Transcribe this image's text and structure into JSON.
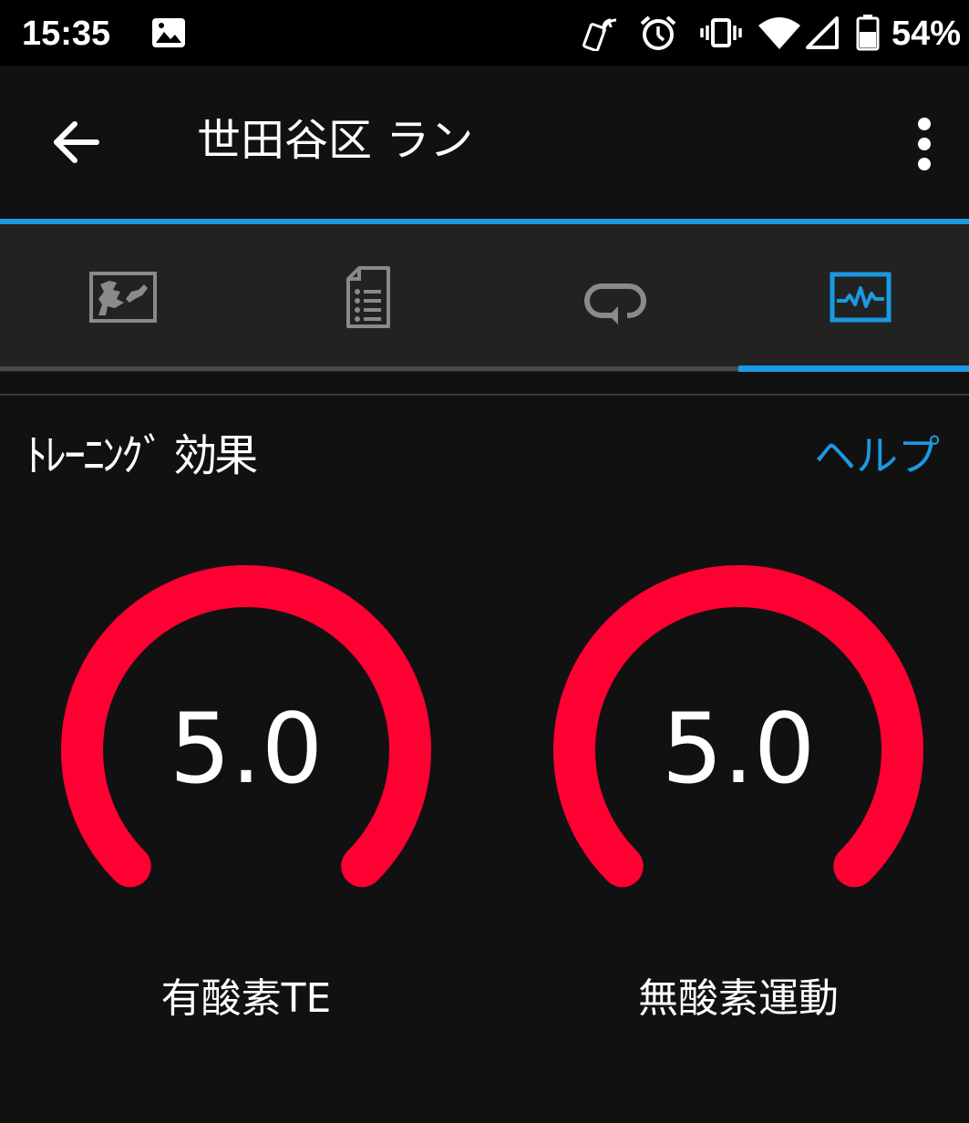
{
  "status_bar": {
    "time": "15:35",
    "battery_percent": "54%",
    "icons": [
      "gallery-icon",
      "nfc-phone-icon",
      "alarm-icon",
      "vibrate-icon",
      "wifi-icon",
      "cell-signal-icon",
      "battery-icon"
    ]
  },
  "app_bar": {
    "title": "世田谷区 ラン",
    "back_icon": "arrow-back-icon",
    "menu_icon": "more-vert-icon"
  },
  "tabs": [
    {
      "icon": "map-icon",
      "selected": false
    },
    {
      "icon": "details-document-icon",
      "selected": false
    },
    {
      "icon": "laps-loop-icon",
      "selected": false
    },
    {
      "icon": "activity-graph-icon",
      "selected": true
    }
  ],
  "content": {
    "section_title": "ﾄﾚｰﾆﾝｸﾞ 効果",
    "help_label": "ヘルプ",
    "gauges": [
      {
        "value": "5.0",
        "label": "有酸素TE",
        "level": 1.0
      },
      {
        "value": "5.0",
        "label": "無酸素運動",
        "level": 1.0
      }
    ]
  },
  "colors": {
    "accent": "#1a9ae0",
    "gauge": "#ff0033",
    "background": "#111112",
    "tab_bar": "#222223",
    "inactive_icon": "#8a8a8a"
  }
}
